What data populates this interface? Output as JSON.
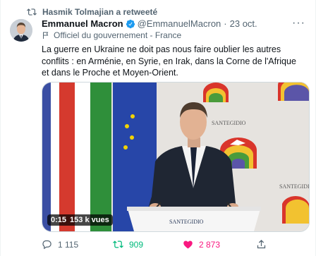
{
  "retweet": {
    "label": "Hasmik Tolmajian a retweeté",
    "icon": "retweet-icon"
  },
  "author": {
    "name": "Emmanuel Macron",
    "handle": "@EmmanuelMacron",
    "separator": "·",
    "date": "23 oct.",
    "verified_color": "#1d9bf0"
  },
  "affiliation": {
    "label": "Officiel du gouvernement - France",
    "icon": "flag-icon"
  },
  "tweet": {
    "text": "La guerre en Ukraine ne doit pas nous faire oublier les autres conflits : en Arménie, en Syrie, en Irak, dans la Corne de l'Afrique et dans le Proche et Moyen-Orient."
  },
  "video": {
    "time": "0:15",
    "views": "153 k vues",
    "podium_text": "SANTEGIDIO",
    "backdrop_text": "SANTEGIDIO"
  },
  "actions": {
    "replies": "1 115",
    "retweets": "909",
    "likes": "2 873"
  },
  "colors": {
    "retweet_active": "#00ba7c",
    "like_active": "#f91880",
    "muted": "#536471"
  }
}
